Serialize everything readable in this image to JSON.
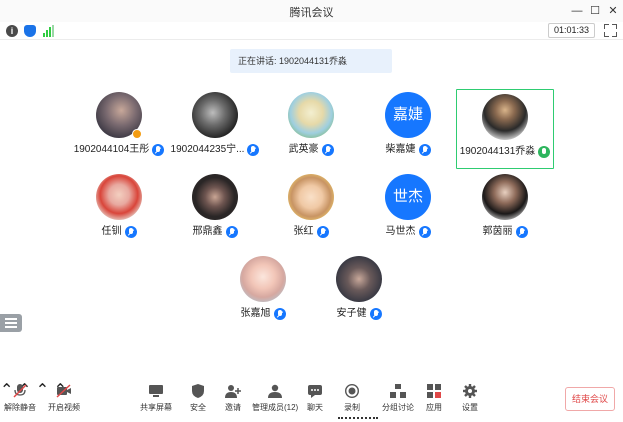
{
  "window": {
    "title": "腾讯会议",
    "controls": [
      "minimize",
      "maximize",
      "close"
    ]
  },
  "infobar": {
    "icons": [
      "info-icon",
      "shield-icon",
      "signal-icon"
    ],
    "timer": "01:01:33"
  },
  "speaking_banner": "正在讲话: 1902044131乔淼",
  "participants": [
    {
      "name": "1902044104王彤",
      "avatar": "photo",
      "mic": "blue"
    },
    {
      "name": "1902044235宁...",
      "avatar": "photo",
      "mic": "blue"
    },
    {
      "name": "武英豪",
      "avatar": "photo",
      "mic": "blue"
    },
    {
      "name": "柴嘉婕",
      "avatar": "嘉婕",
      "mic": "blue"
    },
    {
      "name": "1902044131乔淼",
      "avatar": "photo",
      "mic": "green",
      "active": true
    },
    {
      "name": "任钏",
      "avatar": "photo",
      "mic": "blue"
    },
    {
      "name": "邢鼎鑫",
      "avatar": "photo",
      "mic": "blue"
    },
    {
      "name": "张红",
      "avatar": "photo",
      "mic": "blue"
    },
    {
      "name": "马世杰",
      "avatar": "世杰",
      "mic": "blue"
    },
    {
      "name": "郭茵丽",
      "avatar": "photo",
      "mic": "blue"
    },
    {
      "name": "张嘉旭",
      "avatar": "photo",
      "mic": "blue"
    },
    {
      "name": "安子健",
      "avatar": "photo",
      "mic": "blue"
    }
  ],
  "toolbar": {
    "unmute": "解除静音",
    "video": "开启视频",
    "share": "共享屏幕",
    "security": "安全",
    "invite": "邀请",
    "members": "管理成员(12)",
    "chat": "聊天",
    "record": "录制",
    "breakout": "分组讨论",
    "apps": "应用",
    "settings": "设置",
    "end": "结束会议"
  },
  "colors": {
    "accent": "#1677ff",
    "speaking": "#2ecc71",
    "end": "#e04848"
  }
}
